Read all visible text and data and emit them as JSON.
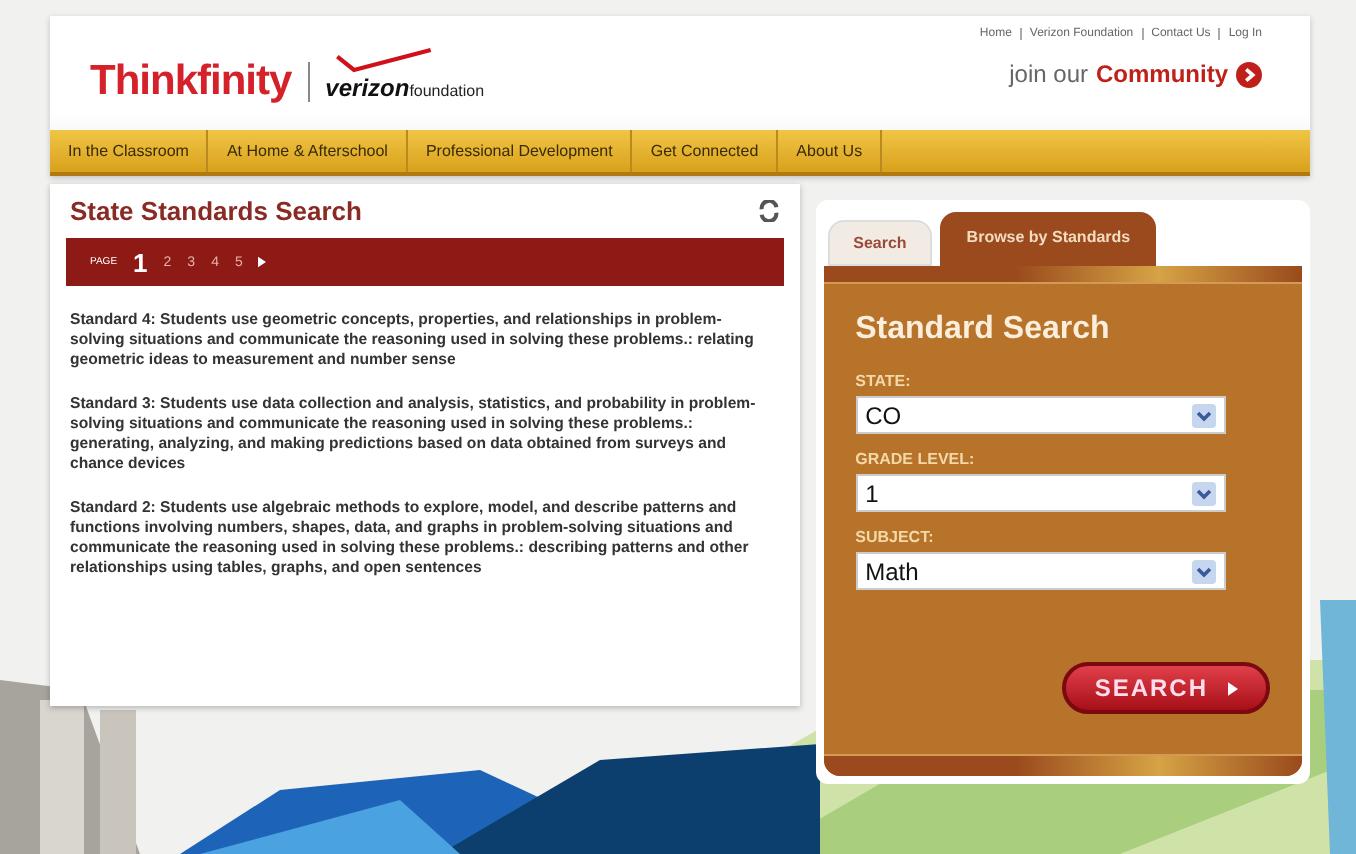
{
  "header": {
    "logo": "Thinkfinity",
    "partner_logo": {
      "brand": "verizon",
      "suffix": "foundation"
    },
    "top_links": [
      "Home",
      "Verizon Foundation",
      "Contact Us",
      "Log In"
    ],
    "community": {
      "prefix": "join our",
      "label": "Community"
    }
  },
  "nav": [
    "In the Classroom",
    "At Home & Afterschool",
    "Professional Development",
    "Get Connected",
    "About Us"
  ],
  "results": {
    "title": "State Standards Search",
    "pager": {
      "label": "PAGE",
      "pages": [
        {
          "label": "1",
          "selected": true
        },
        {
          "label": "2",
          "selected": false
        },
        {
          "label": "3",
          "selected": false
        },
        {
          "label": "4",
          "selected": false
        },
        {
          "label": "5",
          "selected": false
        }
      ]
    },
    "items": [
      "Standard 4: Students use geometric concepts, properties, and relationships in problem-solving situations and communicate the reasoning used in solving these problems.: relating geometric ideas to measurement and number sense",
      "Standard 3: Students use data collection and analysis, statistics, and probability in problem-solving situations and communicate the reasoning used in solving these problems.: generating, analyzing, and making predictions based on data obtained from surveys and chance devices",
      "Standard 2: Students use algebraic methods to explore, model, and describe patterns and functions involving numbers, shapes, data, and graphs in problem-solving situations and communicate the reasoning used in solving these problems.: describing patterns and other relationships using tables, graphs, and open sentences"
    ]
  },
  "search_panel": {
    "tabs": [
      {
        "label": "Search",
        "selected": false
      },
      {
        "label": "Browse by Standards",
        "selected": true
      }
    ],
    "title": "Standard Search",
    "fields": [
      {
        "label": "STATE:",
        "value": "CO"
      },
      {
        "label": "GRADE LEVEL:",
        "value": "1"
      },
      {
        "label": "SUBJECT:",
        "value": "Math"
      }
    ],
    "button": "SEARCH"
  }
}
